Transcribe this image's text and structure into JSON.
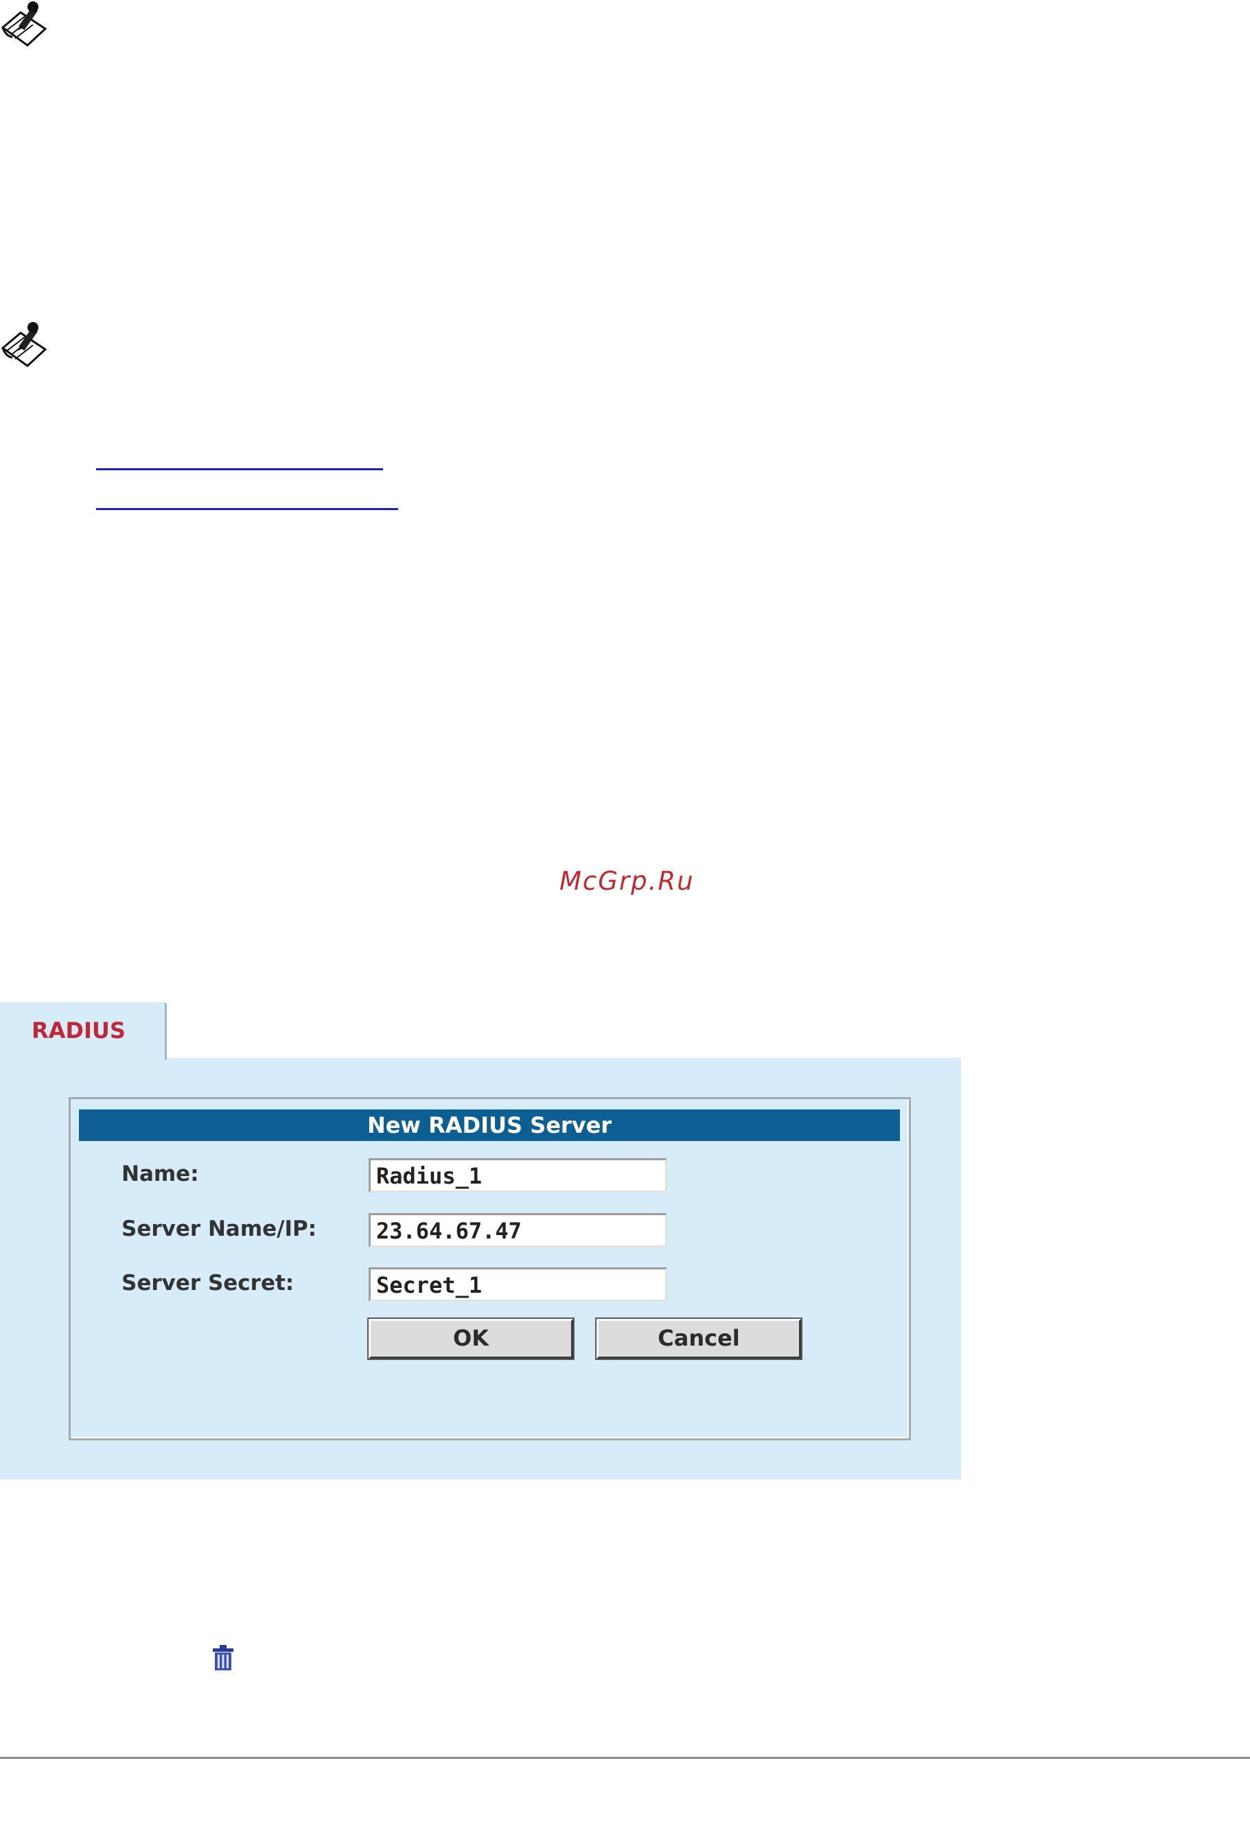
{
  "watermark": "McGrp.Ru",
  "icons": {
    "note": "note-pencil-icon",
    "delete": "trash-icon"
  },
  "radius_panel": {
    "tab_label": "RADIUS",
    "form_title": "New RADIUS Server",
    "fields": [
      {
        "label": "Name:",
        "value": "Radius_1"
      },
      {
        "label": "Server Name/IP:",
        "value": "23.64.67.47"
      },
      {
        "label": "Server Secret:",
        "value": "Secret_1"
      }
    ],
    "buttons": {
      "ok": "OK",
      "cancel": "Cancel"
    }
  },
  "colors": {
    "panel_background": "#d6ecf8",
    "header_bar": "#0d5f93",
    "tab_text": "#c0283a",
    "watermark": "#c0292f",
    "link": "#2020c0"
  }
}
